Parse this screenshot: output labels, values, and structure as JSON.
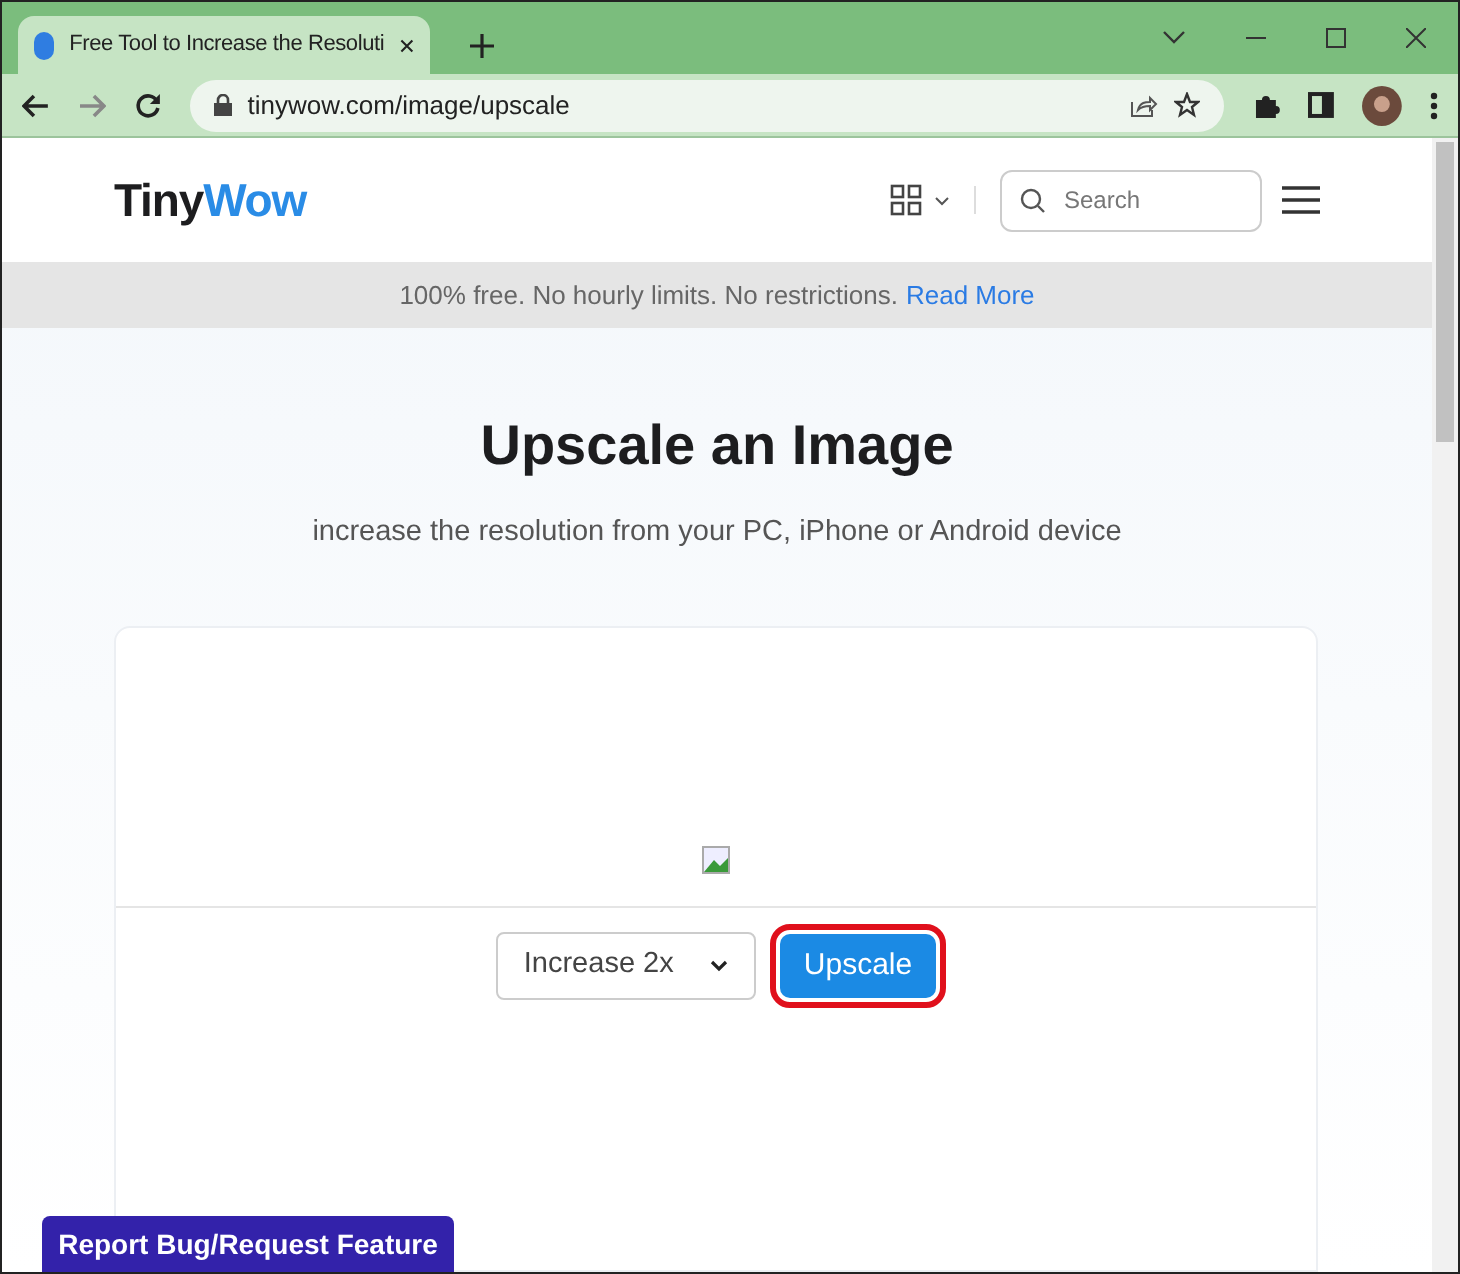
{
  "browser": {
    "tab_title": "Free Tool to Increase the Resoluti",
    "url": "tinywow.com/image/upscale"
  },
  "header": {
    "logo_part_1": "Tiny",
    "logo_part_2": "Wow",
    "search": {
      "placeholder": "Search"
    }
  },
  "banner": {
    "text": "100% free. No hourly limits. No restrictions.",
    "link": "Read More"
  },
  "main": {
    "title": "Upscale an Image",
    "subtitle": "increase the resolution from your PC, iPhone or Android device",
    "scale_select": {
      "value": "Increase 2x"
    },
    "upscale_button": {
      "label": "Upscale",
      "highlighted": true
    }
  },
  "feedback_button": {
    "label": "Report Bug/Request Feature"
  }
}
